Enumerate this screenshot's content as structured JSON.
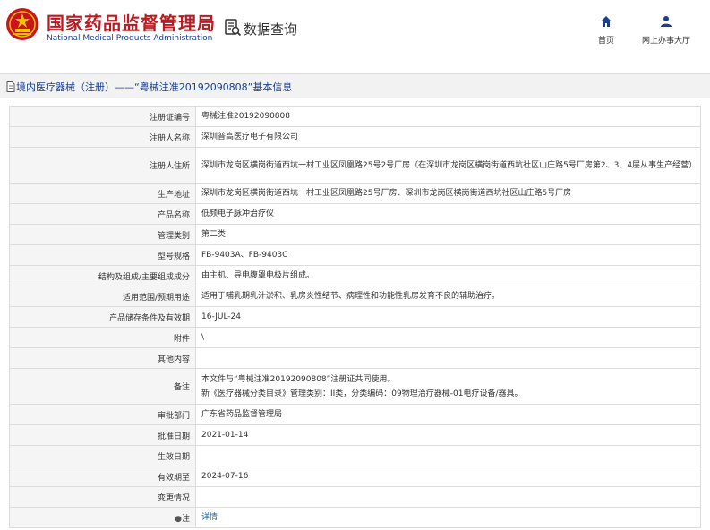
{
  "header": {
    "brand_cn": "国家药品监督管理局",
    "brand_en": "National Medical Products Administration",
    "query_title": "数据查询",
    "nav_home": "首页",
    "nav_hall": "网上办事大厅",
    "brand_color": "#b81c22",
    "link_color": "#1a3f8f"
  },
  "titlebar": {
    "text": "境内医疗器械（注册）——“粤械注准20192090808”基本信息"
  },
  "rows": [
    {
      "label": "注册证编号",
      "value": "粤械注准20192090808"
    },
    {
      "label": "注册人名称",
      "value": "深圳普高医疗电子有限公司"
    },
    {
      "label": "注册人住所",
      "value": "深圳市龙岗区横岗街道西坑一村工业区凤凰路25号2号厂房（在深圳市龙岗区横岗街道西坑社区山庄路5号厂房第2、3、4层从事生产经营）"
    },
    {
      "label": "生产地址",
      "value": "深圳市龙岗区横岗街道西坑一村工业区凤凰路25号厂房、深圳市龙岗区横岗街道西坑社区山庄路5号厂房"
    },
    {
      "label": "产品名称",
      "value": "低频电子脉冲治疗仪"
    },
    {
      "label": "管理类别",
      "value": "第二类"
    },
    {
      "label": "型号规格",
      "value": "FB-9403A、FB-9403C"
    },
    {
      "label": "结构及组成/主要组成成分",
      "value": "由主机、导电腹罩电极片组成。"
    },
    {
      "label": "适用范围/预期用途",
      "value": "适用于哺乳期乳汁淤积、乳房炎性结节、病理性和功能性乳房发育不良的辅助治疗。"
    },
    {
      "label": "产品储存条件及有效期",
      "value": "16-JUL-24"
    },
    {
      "label": "附件",
      "value": "\\"
    },
    {
      "label": "其他内容",
      "value": ""
    },
    {
      "label": "备注",
      "value": "本文件与“粤械注准20192090808”注册证共同使用。",
      "value2": "新《医疗器械分类目录》管理类别：II类，分类编码：09物理治疗器械-01电疗设备/器具。"
    },
    {
      "label": "审批部门",
      "value": "广东省药品监督管理局"
    },
    {
      "label": "批准日期",
      "value": "2021-01-14"
    },
    {
      "label": "生效日期",
      "value": ""
    },
    {
      "label": "有效期至",
      "value": "2024-07-16"
    },
    {
      "label": "变更情况",
      "value": ""
    },
    {
      "label": "注",
      "value": "详情"
    }
  ]
}
